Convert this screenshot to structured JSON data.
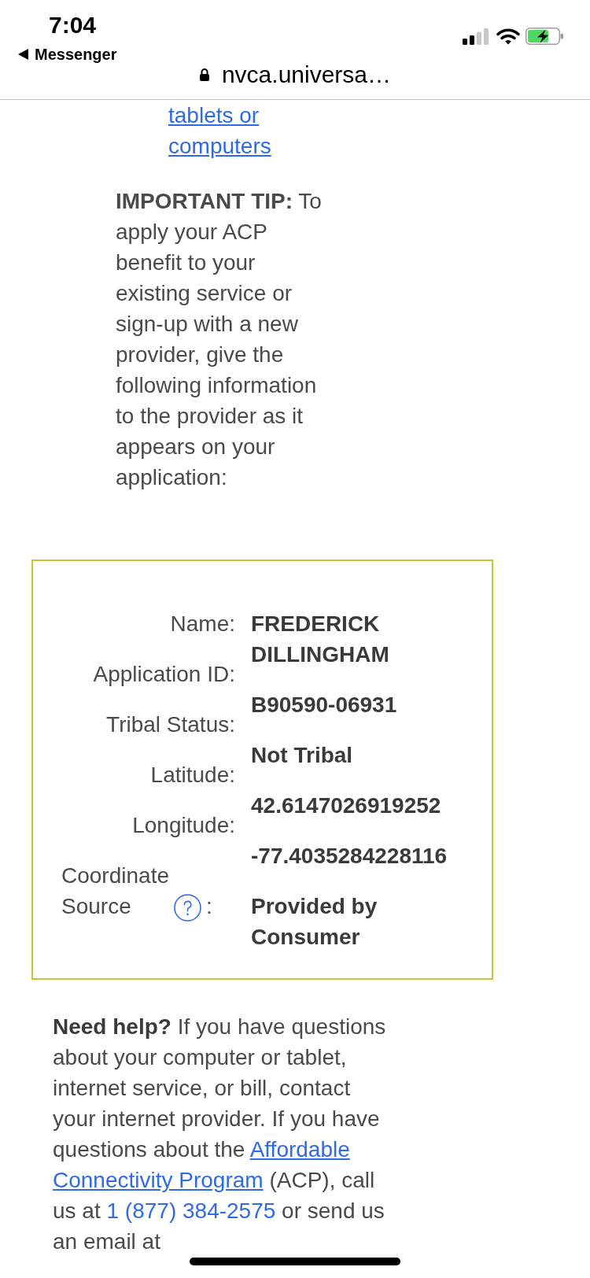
{
  "status_bar": {
    "time": "7:04",
    "back_label": "Messenger"
  },
  "address_bar": {
    "url": "nvca.universa…",
    "secure": true
  },
  "top_link": {
    "text": "tablets or computers"
  },
  "tip": {
    "text": "**IMPORTANT TIP:** To apply your ACP benefit to your existing service or sign-up with a new provider, give the following information to the provider as it appears on your application:"
  },
  "application_details": {
    "rows": [
      {
        "label": "Name:",
        "help": false,
        "value": "FREDERICK DILLINGHAM"
      },
      {
        "label": "Application ID:",
        "help": false,
        "value": "B90590-06931"
      },
      {
        "label": "Tribal Status:",
        "help": false,
        "value": "Not Tribal"
      },
      {
        "label": "Latitude:",
        "help": false,
        "value": "42.6147026919252"
      },
      {
        "label": "Longitude:",
        "help": false,
        "value": "-77.4035284228116"
      },
      {
        "label": "Coordinate Source",
        "help": true,
        "suffix": ":",
        "value": "Provided by Consumer"
      }
    ]
  },
  "help": {
    "segments": [
      {
        "kind": "bold",
        "text": "Need help?"
      },
      {
        "kind": "text",
        "text": " If you have questions about your computer or tablet, internet service, or bill, contact your internet provider. If you have questions about the "
      },
      {
        "kind": "link",
        "parts": [
          "Affordable",
          "Connectivity Program"
        ]
      },
      {
        "kind": "text",
        "text": " (ACP), call us at "
      },
      {
        "kind": "phone",
        "text": "1 (877) 384-2575"
      },
      {
        "kind": "text",
        "text": " or send us an email at"
      }
    ]
  }
}
